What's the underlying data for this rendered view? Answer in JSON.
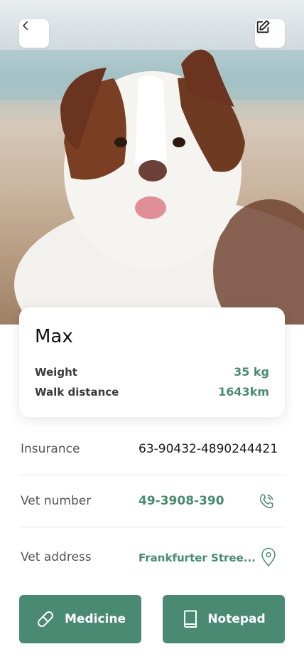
{
  "header": {
    "back_icon": "chevron-left-icon",
    "edit_icon": "edit-icon"
  },
  "pet": {
    "name": "Max",
    "stats": [
      {
        "label": "Weight",
        "value": "35 kg"
      },
      {
        "label": "Walk distance",
        "value": "1643km"
      }
    ]
  },
  "details": {
    "insurance": {
      "label": "Insurance",
      "value": "63-90432-4890244421"
    },
    "vet_number": {
      "label": "Vet number",
      "value": "49-3908-390",
      "icon": "phone-icon"
    },
    "vet_address": {
      "label": "Vet address",
      "value": "Frankfurter Stree...",
      "icon": "location-pin-icon"
    }
  },
  "actions": {
    "medicine": {
      "label": "Medicine",
      "icon": "pill-icon"
    },
    "notepad": {
      "label": "Notepad",
      "icon": "book-icon"
    }
  },
  "colors": {
    "accent": "#4a8a72",
    "label_gray": "#555555",
    "divider": "#e6e6e6"
  }
}
